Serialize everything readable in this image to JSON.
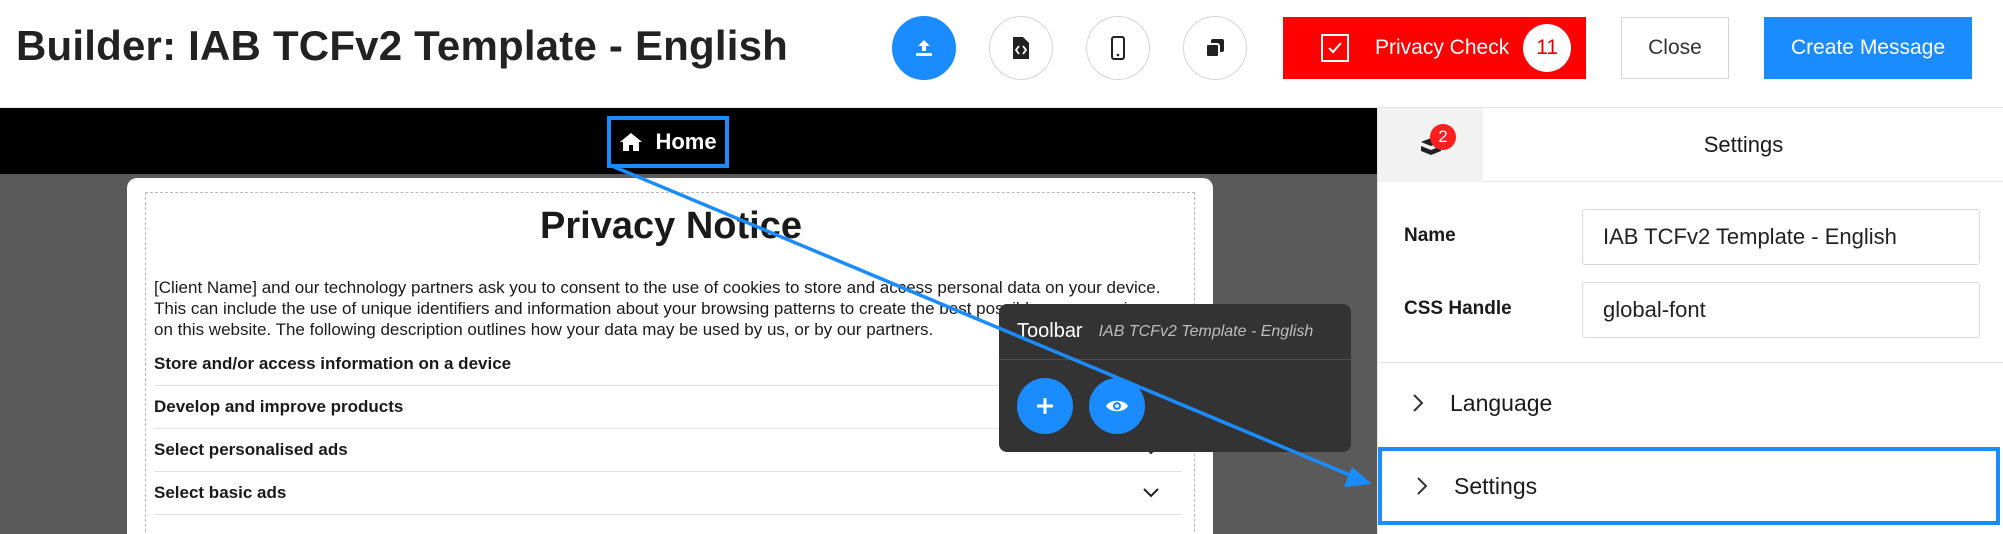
{
  "header": {
    "title": "Builder: IAB TCFv2 Template - English",
    "buttons": {
      "publish_icon": "upload-icon",
      "code_icon": "code-file-icon",
      "mobile_icon": "mobile-icon",
      "copy_icon": "copy-icon"
    },
    "privacy_check": {
      "label": "Privacy Check",
      "count": "11"
    },
    "close_label": "Close",
    "create_label": "Create Message"
  },
  "canvas": {
    "breadcrumb": {
      "label": "Home",
      "icon": "home-icon"
    },
    "notice": {
      "title": "Privacy Notice",
      "body": "[Client Name] and our technology partners ask you to consent to the use of cookies to store and access personal data on your device. This can include the use of unique identifiers and information about your browsing patterns to create the best possible user experience on this website. The following description outlines how your data may be used by us, or by our partners.",
      "purposes": [
        "Store and/or access information on a device",
        "Develop and improve products",
        "Select personalised ads",
        "Select basic ads"
      ]
    },
    "toolbar": {
      "title": "Toolbar",
      "subtitle": "IAB TCFv2 Template - English",
      "add_icon": "plus-icon",
      "preview_icon": "eye-icon"
    }
  },
  "panel": {
    "badge_count": "2",
    "title": "Settings",
    "fields": {
      "name_label": "Name",
      "name_value": "IAB TCFv2 Template - English",
      "css_label": "CSS Handle",
      "css_value": "global-font"
    },
    "sections": [
      {
        "label": "Language"
      },
      {
        "label": "Settings"
      }
    ]
  },
  "colors": {
    "accent": "#1a8cff",
    "privacy_red": "#ff0000",
    "toolbar_bg": "#333333",
    "canvas_bg": "#5a5a5a"
  }
}
